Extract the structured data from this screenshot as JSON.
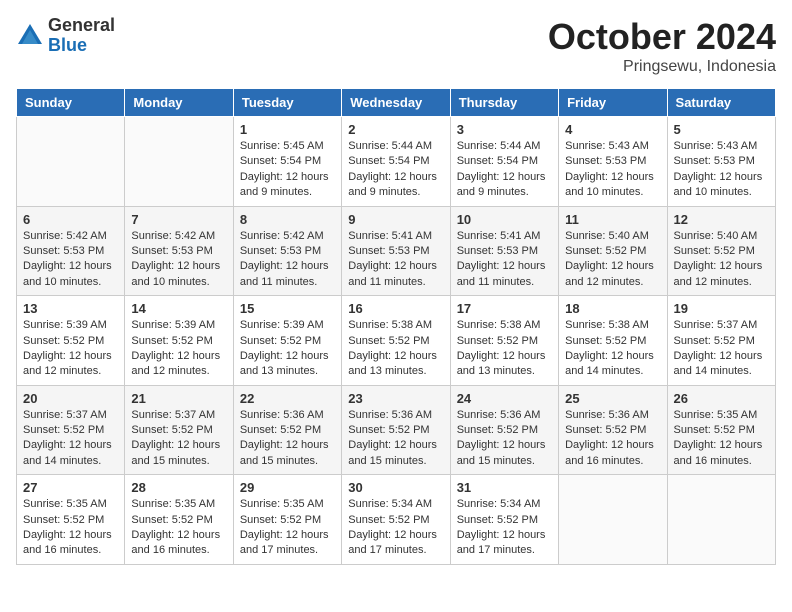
{
  "logo": {
    "general": "General",
    "blue": "Blue"
  },
  "title": "October 2024",
  "subtitle": "Pringsewu, Indonesia",
  "weekdays": [
    "Sunday",
    "Monday",
    "Tuesday",
    "Wednesday",
    "Thursday",
    "Friday",
    "Saturday"
  ],
  "weeks": [
    [
      {
        "day": "",
        "info": ""
      },
      {
        "day": "",
        "info": ""
      },
      {
        "day": "1",
        "sunrise": "5:45 AM",
        "sunset": "5:54 PM",
        "daylight": "12 hours and 9 minutes."
      },
      {
        "day": "2",
        "sunrise": "5:44 AM",
        "sunset": "5:54 PM",
        "daylight": "12 hours and 9 minutes."
      },
      {
        "day": "3",
        "sunrise": "5:44 AM",
        "sunset": "5:54 PM",
        "daylight": "12 hours and 9 minutes."
      },
      {
        "day": "4",
        "sunrise": "5:43 AM",
        "sunset": "5:53 PM",
        "daylight": "12 hours and 10 minutes."
      },
      {
        "day": "5",
        "sunrise": "5:43 AM",
        "sunset": "5:53 PM",
        "daylight": "12 hours and 10 minutes."
      }
    ],
    [
      {
        "day": "6",
        "sunrise": "5:42 AM",
        "sunset": "5:53 PM",
        "daylight": "12 hours and 10 minutes."
      },
      {
        "day": "7",
        "sunrise": "5:42 AM",
        "sunset": "5:53 PM",
        "daylight": "12 hours and 10 minutes."
      },
      {
        "day": "8",
        "sunrise": "5:42 AM",
        "sunset": "5:53 PM",
        "daylight": "12 hours and 11 minutes."
      },
      {
        "day": "9",
        "sunrise": "5:41 AM",
        "sunset": "5:53 PM",
        "daylight": "12 hours and 11 minutes."
      },
      {
        "day": "10",
        "sunrise": "5:41 AM",
        "sunset": "5:53 PM",
        "daylight": "12 hours and 11 minutes."
      },
      {
        "day": "11",
        "sunrise": "5:40 AM",
        "sunset": "5:52 PM",
        "daylight": "12 hours and 12 minutes."
      },
      {
        "day": "12",
        "sunrise": "5:40 AM",
        "sunset": "5:52 PM",
        "daylight": "12 hours and 12 minutes."
      }
    ],
    [
      {
        "day": "13",
        "sunrise": "5:39 AM",
        "sunset": "5:52 PM",
        "daylight": "12 hours and 12 minutes."
      },
      {
        "day": "14",
        "sunrise": "5:39 AM",
        "sunset": "5:52 PM",
        "daylight": "12 hours and 12 minutes."
      },
      {
        "day": "15",
        "sunrise": "5:39 AM",
        "sunset": "5:52 PM",
        "daylight": "12 hours and 13 minutes."
      },
      {
        "day": "16",
        "sunrise": "5:38 AM",
        "sunset": "5:52 PM",
        "daylight": "12 hours and 13 minutes."
      },
      {
        "day": "17",
        "sunrise": "5:38 AM",
        "sunset": "5:52 PM",
        "daylight": "12 hours and 13 minutes."
      },
      {
        "day": "18",
        "sunrise": "5:38 AM",
        "sunset": "5:52 PM",
        "daylight": "12 hours and 14 minutes."
      },
      {
        "day": "19",
        "sunrise": "5:37 AM",
        "sunset": "5:52 PM",
        "daylight": "12 hours and 14 minutes."
      }
    ],
    [
      {
        "day": "20",
        "sunrise": "5:37 AM",
        "sunset": "5:52 PM",
        "daylight": "12 hours and 14 minutes."
      },
      {
        "day": "21",
        "sunrise": "5:37 AM",
        "sunset": "5:52 PM",
        "daylight": "12 hours and 15 minutes."
      },
      {
        "day": "22",
        "sunrise": "5:36 AM",
        "sunset": "5:52 PM",
        "daylight": "12 hours and 15 minutes."
      },
      {
        "day": "23",
        "sunrise": "5:36 AM",
        "sunset": "5:52 PM",
        "daylight": "12 hours and 15 minutes."
      },
      {
        "day": "24",
        "sunrise": "5:36 AM",
        "sunset": "5:52 PM",
        "daylight": "12 hours and 15 minutes."
      },
      {
        "day": "25",
        "sunrise": "5:36 AM",
        "sunset": "5:52 PM",
        "daylight": "12 hours and 16 minutes."
      },
      {
        "day": "26",
        "sunrise": "5:35 AM",
        "sunset": "5:52 PM",
        "daylight": "12 hours and 16 minutes."
      }
    ],
    [
      {
        "day": "27",
        "sunrise": "5:35 AM",
        "sunset": "5:52 PM",
        "daylight": "12 hours and 16 minutes."
      },
      {
        "day": "28",
        "sunrise": "5:35 AM",
        "sunset": "5:52 PM",
        "daylight": "12 hours and 16 minutes."
      },
      {
        "day": "29",
        "sunrise": "5:35 AM",
        "sunset": "5:52 PM",
        "daylight": "12 hours and 17 minutes."
      },
      {
        "day": "30",
        "sunrise": "5:34 AM",
        "sunset": "5:52 PM",
        "daylight": "12 hours and 17 minutes."
      },
      {
        "day": "31",
        "sunrise": "5:34 AM",
        "sunset": "5:52 PM",
        "daylight": "12 hours and 17 minutes."
      },
      {
        "day": "",
        "info": ""
      },
      {
        "day": "",
        "info": ""
      }
    ]
  ]
}
